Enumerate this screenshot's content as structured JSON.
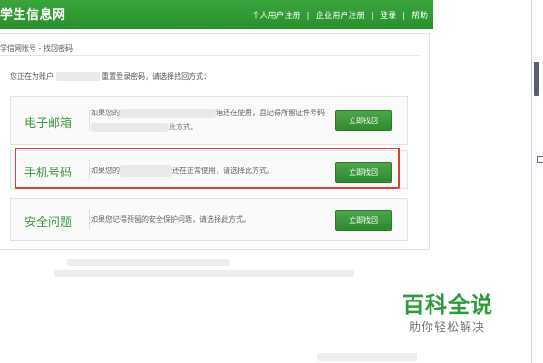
{
  "header": {
    "logo": "学生信息网",
    "nav": [
      "个人用户注册",
      "企业用户注册",
      "登录",
      "帮助"
    ],
    "separator": "|"
  },
  "breadcrumb": "学信网账号 - 找回密码",
  "intro": {
    "prefix": "您正在为账户",
    "suffix": "重置登录密码，请选择找回方式："
  },
  "options": [
    {
      "title": "电子邮箱",
      "desc_line1_prefix": "如果您的",
      "desc_line1_suffix": "箱还在使用，且记得所留证件号码",
      "desc_line2": "此方式。",
      "button": "立即找回"
    },
    {
      "title": "手机号码",
      "desc_prefix": "如果您的",
      "desc_suffix": "还在正常使用，请选择此方式。",
      "button": "立即找回"
    },
    {
      "title": "安全问题",
      "desc": "如果您记得预留的安全保护问题，请选择此方式。",
      "button": "立即找回"
    }
  ],
  "watermark": {
    "main": "百科全说",
    "sub": "助你轻松解决"
  },
  "colors": {
    "brand_green": "#2e9631",
    "title_green": "#3c9a3e",
    "highlight_red": "#d9403a"
  }
}
